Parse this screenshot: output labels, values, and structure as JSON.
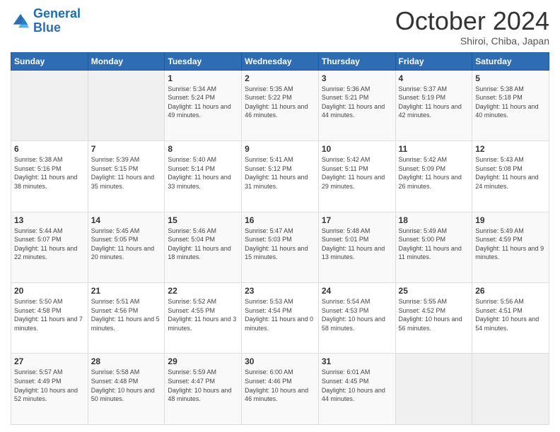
{
  "logo": {
    "line1": "General",
    "line2": "Blue"
  },
  "header": {
    "month": "October 2024",
    "location": "Shiroi, Chiba, Japan"
  },
  "days_of_week": [
    "Sunday",
    "Monday",
    "Tuesday",
    "Wednesday",
    "Thursday",
    "Friday",
    "Saturday"
  ],
  "weeks": [
    [
      {
        "day": "",
        "content": ""
      },
      {
        "day": "",
        "content": ""
      },
      {
        "day": "1",
        "content": "Sunrise: 5:34 AM\nSunset: 5:24 PM\nDaylight: 11 hours and 49 minutes."
      },
      {
        "day": "2",
        "content": "Sunrise: 5:35 AM\nSunset: 5:22 PM\nDaylight: 11 hours and 46 minutes."
      },
      {
        "day": "3",
        "content": "Sunrise: 5:36 AM\nSunset: 5:21 PM\nDaylight: 11 hours and 44 minutes."
      },
      {
        "day": "4",
        "content": "Sunrise: 5:37 AM\nSunset: 5:19 PM\nDaylight: 11 hours and 42 minutes."
      },
      {
        "day": "5",
        "content": "Sunrise: 5:38 AM\nSunset: 5:18 PM\nDaylight: 11 hours and 40 minutes."
      }
    ],
    [
      {
        "day": "6",
        "content": "Sunrise: 5:38 AM\nSunset: 5:16 PM\nDaylight: 11 hours and 38 minutes."
      },
      {
        "day": "7",
        "content": "Sunrise: 5:39 AM\nSunset: 5:15 PM\nDaylight: 11 hours and 35 minutes."
      },
      {
        "day": "8",
        "content": "Sunrise: 5:40 AM\nSunset: 5:14 PM\nDaylight: 11 hours and 33 minutes."
      },
      {
        "day": "9",
        "content": "Sunrise: 5:41 AM\nSunset: 5:12 PM\nDaylight: 11 hours and 31 minutes."
      },
      {
        "day": "10",
        "content": "Sunrise: 5:42 AM\nSunset: 5:11 PM\nDaylight: 11 hours and 29 minutes."
      },
      {
        "day": "11",
        "content": "Sunrise: 5:42 AM\nSunset: 5:09 PM\nDaylight: 11 hours and 26 minutes."
      },
      {
        "day": "12",
        "content": "Sunrise: 5:43 AM\nSunset: 5:08 PM\nDaylight: 11 hours and 24 minutes."
      }
    ],
    [
      {
        "day": "13",
        "content": "Sunrise: 5:44 AM\nSunset: 5:07 PM\nDaylight: 11 hours and 22 minutes."
      },
      {
        "day": "14",
        "content": "Sunrise: 5:45 AM\nSunset: 5:05 PM\nDaylight: 11 hours and 20 minutes."
      },
      {
        "day": "15",
        "content": "Sunrise: 5:46 AM\nSunset: 5:04 PM\nDaylight: 11 hours and 18 minutes."
      },
      {
        "day": "16",
        "content": "Sunrise: 5:47 AM\nSunset: 5:03 PM\nDaylight: 11 hours and 15 minutes."
      },
      {
        "day": "17",
        "content": "Sunrise: 5:48 AM\nSunset: 5:01 PM\nDaylight: 11 hours and 13 minutes."
      },
      {
        "day": "18",
        "content": "Sunrise: 5:49 AM\nSunset: 5:00 PM\nDaylight: 11 hours and 11 minutes."
      },
      {
        "day": "19",
        "content": "Sunrise: 5:49 AM\nSunset: 4:59 PM\nDaylight: 11 hours and 9 minutes."
      }
    ],
    [
      {
        "day": "20",
        "content": "Sunrise: 5:50 AM\nSunset: 4:58 PM\nDaylight: 11 hours and 7 minutes."
      },
      {
        "day": "21",
        "content": "Sunrise: 5:51 AM\nSunset: 4:56 PM\nDaylight: 11 hours and 5 minutes."
      },
      {
        "day": "22",
        "content": "Sunrise: 5:52 AM\nSunset: 4:55 PM\nDaylight: 11 hours and 3 minutes."
      },
      {
        "day": "23",
        "content": "Sunrise: 5:53 AM\nSunset: 4:54 PM\nDaylight: 11 hours and 0 minutes."
      },
      {
        "day": "24",
        "content": "Sunrise: 5:54 AM\nSunset: 4:53 PM\nDaylight: 10 hours and 58 minutes."
      },
      {
        "day": "25",
        "content": "Sunrise: 5:55 AM\nSunset: 4:52 PM\nDaylight: 10 hours and 56 minutes."
      },
      {
        "day": "26",
        "content": "Sunrise: 5:56 AM\nSunset: 4:51 PM\nDaylight: 10 hours and 54 minutes."
      }
    ],
    [
      {
        "day": "27",
        "content": "Sunrise: 5:57 AM\nSunset: 4:49 PM\nDaylight: 10 hours and 52 minutes."
      },
      {
        "day": "28",
        "content": "Sunrise: 5:58 AM\nSunset: 4:48 PM\nDaylight: 10 hours and 50 minutes."
      },
      {
        "day": "29",
        "content": "Sunrise: 5:59 AM\nSunset: 4:47 PM\nDaylight: 10 hours and 48 minutes."
      },
      {
        "day": "30",
        "content": "Sunrise: 6:00 AM\nSunset: 4:46 PM\nDaylight: 10 hours and 46 minutes."
      },
      {
        "day": "31",
        "content": "Sunrise: 6:01 AM\nSunset: 4:45 PM\nDaylight: 10 hours and 44 minutes."
      },
      {
        "day": "",
        "content": ""
      },
      {
        "day": "",
        "content": ""
      }
    ]
  ]
}
